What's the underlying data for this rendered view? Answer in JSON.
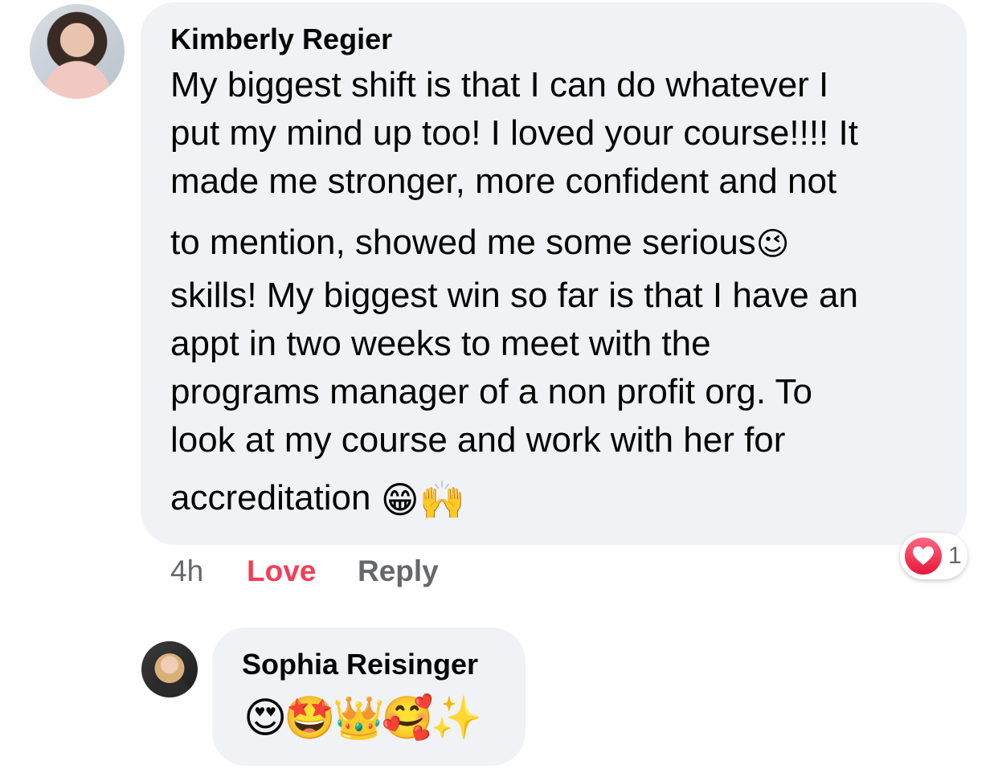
{
  "comment": {
    "author": "Kimberly Regier",
    "lines": [
      "My biggest shift is that I can do whatever I",
      "put my mind up too! I loved your course!!!! It",
      "made me stronger, more confident and not",
      "to mention, showed me some serious",
      "skills! My biggest win so far is that I have an",
      "appt in two weeks to meet with the",
      "programs manager of a non profit org. To",
      "look at my course and work with her for",
      "accreditation"
    ],
    "emoji_after_line4": "😉",
    "emoji_after_last": "😁🙌",
    "time": "4h",
    "love_label": "Love",
    "reply_label": "Reply",
    "reaction_count": "1"
  },
  "reply": {
    "author": "Sophia Reisinger",
    "emojis": "😍🤩👑🥰✨"
  },
  "colors": {
    "bubble": "#f0f2f5",
    "love": "#f33e58",
    "meta": "#65676b"
  }
}
